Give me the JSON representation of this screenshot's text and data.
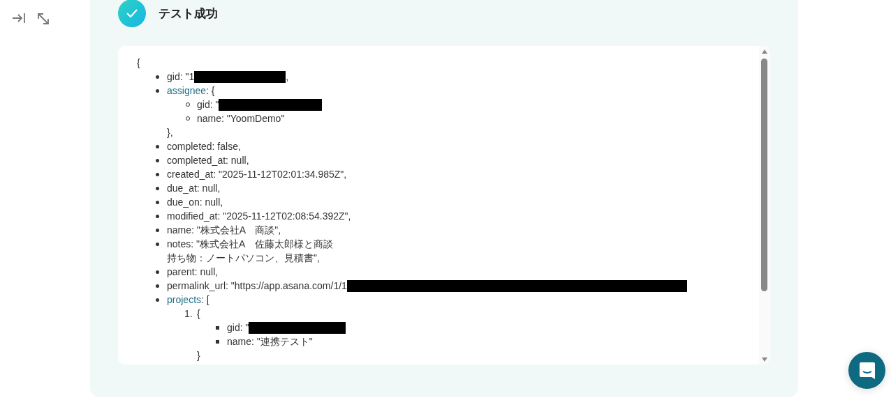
{
  "sidebar": {
    "tools": [
      {
        "kind": "collapse"
      },
      {
        "kind": "expand"
      }
    ]
  },
  "result": {
    "success": true,
    "title": "テスト成功",
    "output": {
      "open": "{",
      "items": [
        {
          "kind": "field",
          "text": "gid: \"1",
          "redacted": true,
          "after": ","
        },
        {
          "kind": "object",
          "key": "assignee",
          "open": ": {",
          "close": "},",
          "items": [
            {
              "kind": "field",
              "text": "gid: \"",
              "redacted": true
            },
            {
              "kind": "field",
              "text": "name: \"YoomDemo\""
            }
          ]
        },
        {
          "kind": "field",
          "text": "completed: false,"
        },
        {
          "kind": "field",
          "text": "completed_at: null,"
        },
        {
          "kind": "field",
          "text": "created_at: \"2025-11-12T02:01:34.985Z\","
        },
        {
          "kind": "field",
          "text": "due_at: null,"
        },
        {
          "kind": "field",
          "text": "due_on: null,"
        },
        {
          "kind": "field",
          "text": "modified_at: \"2025-11-12T02:08:54.392Z\","
        },
        {
          "kind": "field",
          "text": "name: \"株式会社A　商談\","
        },
        {
          "kind": "field",
          "text": "notes: \"株式会社A　佐藤太郎様と商談",
          "continuation": "持ち物：ノートパソコン、見積書\","
        },
        {
          "kind": "field",
          "text": "parent: null,"
        },
        {
          "kind": "field",
          "text": "permalink_url: \"https://app.asana.com/1/1",
          "redacted": true
        },
        {
          "kind": "array",
          "key": "projects",
          "open": ": [",
          "items": [
            {
              "kind": "entry",
              "number": "1.",
              "open": "{",
              "close": "}",
              "items": [
                {
                  "kind": "field",
                  "text": "gid: \"",
                  "redacted": true
                },
                {
                  "kind": "field",
                  "text": "name: \"連携テスト\""
                }
              ]
            }
          ]
        }
      ]
    }
  },
  "chat": {
    "kind": "chat"
  }
}
